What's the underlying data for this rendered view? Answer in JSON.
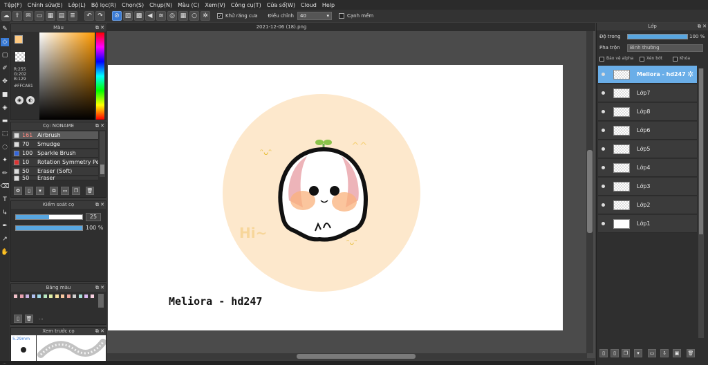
{
  "menu": [
    "Tệp(F)",
    "Chỉnh sửa(E)",
    "Lớp(L)",
    "Bộ lọc(R)",
    "Chọn(S)",
    "Chụp(N)",
    "Màu (C)",
    "Xem(V)",
    "Công cụ(T)",
    "Cửa sổ(W)",
    "Cloud",
    "Help"
  ],
  "toolbar": {
    "antialias_label": "Khử răng cưa",
    "adjust_label": "Điều chỉnh",
    "adjust_value": "40",
    "soft_edge_label": "Cạnh mềm"
  },
  "color_panel": {
    "title": "Màu",
    "r": "R:255",
    "g": "G:202",
    "b": "B:129",
    "hex": "#FFCA81",
    "fg_color": "#ffca81"
  },
  "brush_panel": {
    "title": "Cọ: NONAME",
    "brushes": [
      {
        "size": "161",
        "name": "Airbrush",
        "color": "#dddddd"
      },
      {
        "size": "70",
        "name": "Smudge",
        "color": "#dddddd"
      },
      {
        "size": "100",
        "name": "Sparkle Brush",
        "color": "#3366dd"
      },
      {
        "size": "10",
        "name": "Rotation Symmetry Pen",
        "color": "#dd3333"
      },
      {
        "size": "50",
        "name": "Eraser (Soft)",
        "color": "#dddddd"
      },
      {
        "size": "50",
        "name": "Eraser",
        "color": "#dddddd"
      }
    ]
  },
  "control_panel": {
    "title": "Kiểm soát cọ",
    "size_value": "25",
    "size_fraction": 0.5,
    "opacity_value": "100 %",
    "opacity_fraction": 1.0
  },
  "palette_panel": {
    "title": "Bảng màu",
    "more": "...",
    "swatches": [
      "#f0c0c8",
      "#e8a0b0",
      "#c8b0e0",
      "#b0c0f0",
      "#a0d8e8",
      "#b8e8c0",
      "#e0f0a8",
      "#f8e0a0",
      "#f8c8a0",
      "#f0a8a0",
      "#d0d0d0",
      "#a8e0d8",
      "#d8b8f0",
      "#f8d0e0"
    ]
  },
  "preview_panel": {
    "title": "Xem trước cọ",
    "size": "5.29mm"
  },
  "document": {
    "tab": "2021-12-06 (18).png",
    "signature": "Meliora - hd247",
    "circle_color": "#fde8cc"
  },
  "status": "...",
  "layer_panel": {
    "title": "Lớp",
    "opacity_label": "Độ trong",
    "opacity_value": "100 %",
    "blend_label": "Pha trộn",
    "blend_value": "Bình thường",
    "protect_alpha": "Bảo vệ alpha",
    "clipping": "Xén bớt",
    "lock": "Khóa",
    "layers": [
      {
        "name": "Meliora - hd247",
        "active": true
      },
      {
        "name": "Lớp7",
        "active": false
      },
      {
        "name": "Lớp8",
        "active": false
      },
      {
        "name": "Lớp6",
        "active": false
      },
      {
        "name": "Lớp5",
        "active": false
      },
      {
        "name": "Lớp4",
        "active": false
      },
      {
        "name": "Lớp3",
        "active": false
      },
      {
        "name": "Lớp2",
        "active": false
      },
      {
        "name": "Lớp1",
        "active": false
      }
    ]
  }
}
